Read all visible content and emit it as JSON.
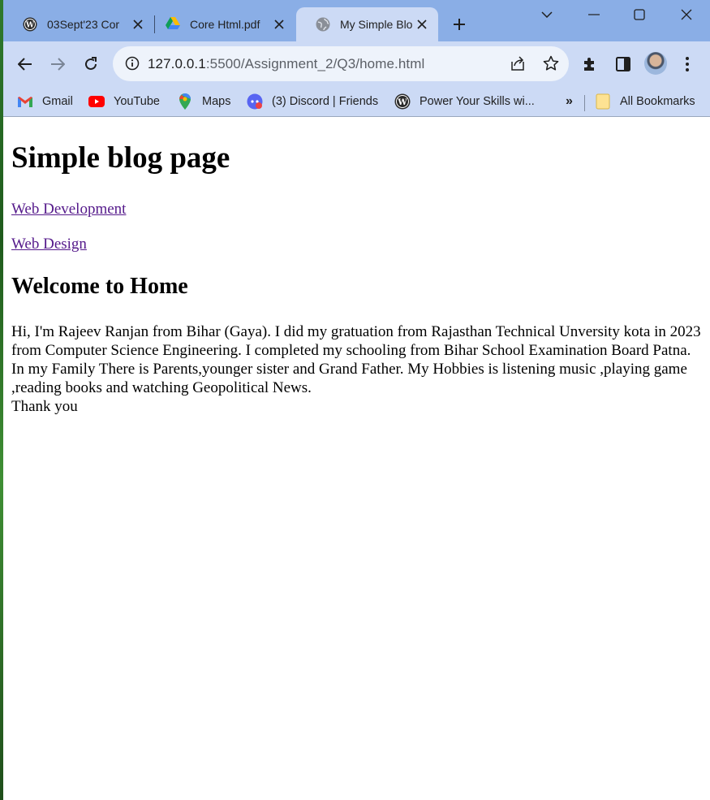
{
  "browser": {
    "tabs": [
      {
        "title": "03Sept'23 Cor",
        "active": false,
        "favicon": "wordpress-icon"
      },
      {
        "title": "Core Html.pdf",
        "active": false,
        "favicon": "google-drive-icon"
      },
      {
        "title": "My Simple Blo",
        "active": true,
        "favicon": "globe-icon"
      }
    ],
    "url_host": "127.0.0.1",
    "url_rest": ":5500/Assignment_2/Q3/home.html",
    "bookmarks": [
      {
        "label": "Gmail",
        "icon": "gmail-icon"
      },
      {
        "label": "YouTube",
        "icon": "youtube-icon"
      },
      {
        "label": "Maps",
        "icon": "maps-icon"
      },
      {
        "label": "(3) Discord | Friends",
        "icon": "discord-icon"
      },
      {
        "label": "Power Your Skills wi...",
        "icon": "wordpress-icon"
      }
    ],
    "overflow_label": "»",
    "all_bookmarks_label": "All Bookmarks"
  },
  "page": {
    "title": "Simple blog page",
    "links": [
      "Web Development",
      "Web Design"
    ],
    "heading": "Welcome to Home",
    "paragraph": "Hi, I'm Rajeev Ranjan from Bihar (Gaya). I did my gratuation from Rajasthan Technical Unversity kota in 2023 from Computer Science Engineering. I completed my schooling from Bihar School Examination Board Patna. In my Family There is Parents,younger sister and Grand Father. My Hobbies is listening music ,playing game ,reading books and watching Geopolitical News.",
    "closing": "Thank you"
  },
  "colors": {
    "tabstrip": "#8aaee6",
    "toolbar": "#ccdaf5",
    "visited_link": "#551a8b"
  }
}
